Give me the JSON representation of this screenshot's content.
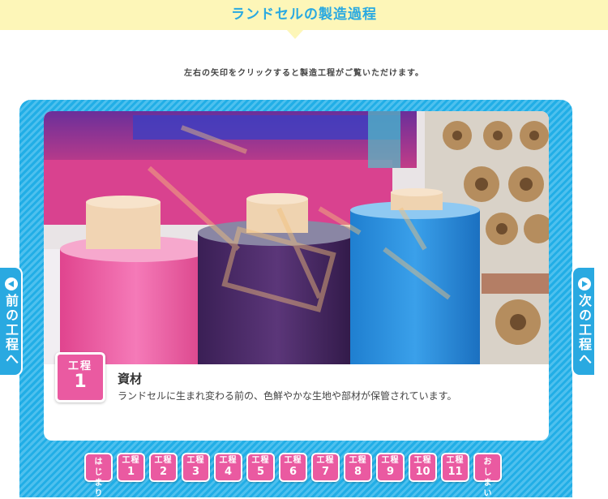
{
  "header": {
    "title": "ランドセルの製造過程"
  },
  "instruction": "左右の矢印をクリックすると製造工程がご覧いただけます。",
  "current_step": {
    "badge_label": "工程",
    "badge_number": "1",
    "title": "資材",
    "description": "ランドセルに生まれ変わる前の、色鮮やかな生地や部材が保管されています。",
    "photo": "material-rolls-photo"
  },
  "prev_tab": {
    "label": "前の工程へ",
    "icon": "arrow-left-circle-icon"
  },
  "next_tab": {
    "label": "次の工程へ",
    "icon": "arrow-right-circle-icon"
  },
  "step_nav": {
    "start": "はじまり",
    "end": "おしまい",
    "step_label": "工程",
    "steps": [
      "1",
      "2",
      "3",
      "4",
      "5",
      "6",
      "7",
      "8",
      "9",
      "10",
      "11"
    ]
  },
  "colors": {
    "accent_blue": "#29a9e1",
    "accent_pink": "#ea5aa1",
    "title_band": "#fdf6b8"
  }
}
